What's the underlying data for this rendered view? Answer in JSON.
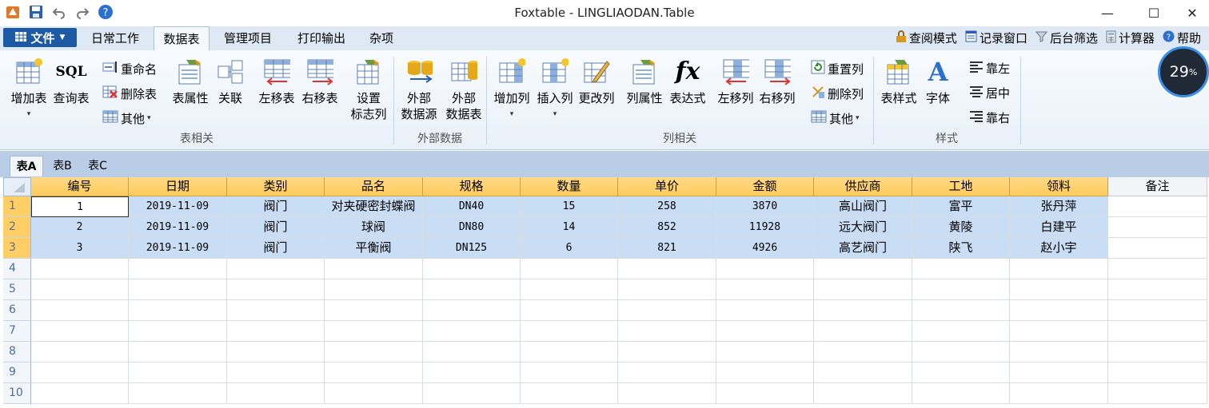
{
  "window": {
    "title": "Foxtable - LINGLIAODAN.Table",
    "minimize_glyph": "—",
    "maximize_glyph": "☐",
    "close_glyph": "✕"
  },
  "quick_access": [
    "app-icon",
    "save-icon",
    "undo-icon",
    "redo-icon",
    "help-icon"
  ],
  "file_menu": {
    "label": "文件",
    "icon": "grid-icon"
  },
  "ribbon_tabs": [
    {
      "label": "日常工作",
      "active": false
    },
    {
      "label": "数据表",
      "active": true
    },
    {
      "label": "管理项目",
      "active": false
    },
    {
      "label": "打印输出",
      "active": false
    },
    {
      "label": "杂项",
      "active": false
    }
  ],
  "right_tools": [
    {
      "label": "查阅模式",
      "icon": "lock-icon"
    },
    {
      "label": "记录窗口",
      "icon": "window-icon"
    },
    {
      "label": "后台筛选",
      "icon": "funnel-icon"
    },
    {
      "label": "计算器",
      "icon": "calculator-icon"
    },
    {
      "label": "帮助",
      "icon": "help-icon"
    }
  ],
  "ribbon": {
    "table_group": {
      "label": "表相关",
      "add_table": "增加表",
      "query_table": "查询表",
      "query_icon_text": "SQL",
      "rename": "重命名",
      "delete_table": "删除表",
      "other": "其他",
      "table_props": "表属性",
      "relation": "关联",
      "move_left": "左移表",
      "move_right": "右移表",
      "set_flag_1": "设置",
      "set_flag_2": "标志列"
    },
    "external_group": {
      "label": "外部数据",
      "ext_source_1": "外部",
      "ext_source_2": "数据源",
      "ext_table_1": "外部",
      "ext_table_2": "数据表"
    },
    "column_group": {
      "label": "列相关",
      "add_col": "增加列",
      "insert_col": "插入列",
      "edit_col": "更改列",
      "col_props": "列属性",
      "expression": "表达式",
      "expression_icon_text": "fx",
      "move_col_left": "左移列",
      "move_col_right": "右移列",
      "reset_col": "重置列",
      "delete_col": "删除列",
      "other": "其他"
    },
    "style_group": {
      "label": "样式",
      "table_style": "表样式",
      "font": "字体",
      "font_icon_text": "A",
      "align_left": "靠左",
      "align_center": "居中",
      "align_right": "靠右"
    }
  },
  "gauge": {
    "value": "29",
    "unit": "%"
  },
  "sheet_tabs": [
    {
      "label": "表A",
      "active": true
    },
    {
      "label": "表B",
      "active": false
    },
    {
      "label": "表C",
      "active": false
    }
  ],
  "table": {
    "columns": [
      "编号",
      "日期",
      "类别",
      "品名",
      "规格",
      "数量",
      "单价",
      "金额",
      "供应商",
      "工地",
      "领料",
      "备注"
    ],
    "rows": [
      [
        "1",
        "2019-11-09",
        "阀门",
        "对夹硬密封蝶阀",
        "DN40",
        "15",
        "258",
        "3870",
        "高山阀门",
        "富平",
        "张丹萍",
        ""
      ],
      [
        "2",
        "2019-11-09",
        "阀门",
        "球阀",
        "DN80",
        "14",
        "852",
        "11928",
        "远大阀门",
        "黄陵",
        "白建平",
        ""
      ],
      [
        "3",
        "2019-11-09",
        "阀门",
        "平衡阀",
        "DN125",
        "6",
        "821",
        "4926",
        "高艺阀门",
        "陕飞",
        "赵小宇",
        ""
      ]
    ],
    "row_numbers": [
      "1",
      "2",
      "3",
      "4",
      "5",
      "6",
      "7",
      "8",
      "9",
      "10"
    ]
  },
  "colors": {
    "header_fill": "#ffcb5c",
    "selected_row_fill": "#c9ddf5",
    "file_button": "#1d5aa6"
  }
}
